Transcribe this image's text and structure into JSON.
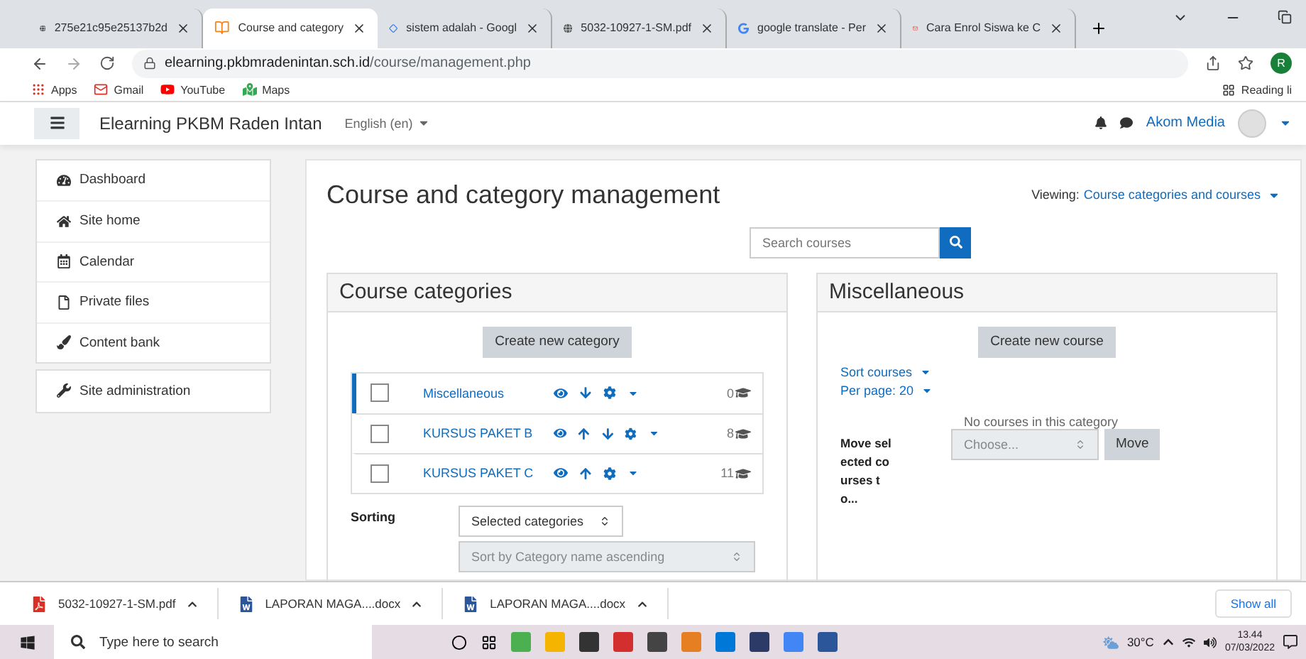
{
  "browser": {
    "tabs": [
      {
        "title": "275e21c95e25137b2d",
        "selected": false,
        "kind": "globe"
      },
      {
        "title": "Course and category",
        "selected": true,
        "kind": "moodle"
      },
      {
        "title": "sistem adalah - Googl",
        "selected": false,
        "kind": "diamond"
      },
      {
        "title": "5032-10927-1-SM.pdf",
        "selected": false,
        "kind": "globe"
      },
      {
        "title": "google translate - Per",
        "selected": false,
        "kind": "google"
      },
      {
        "title": "Cara Enrol Siswa ke C",
        "selected": false,
        "kind": "mail"
      }
    ],
    "address": {
      "host": "elearning.pkbmradenintan.sch.id",
      "path": "/course/management.php"
    },
    "profile_letter": "R",
    "bookmarks": [
      {
        "label": "Apps",
        "kind": "apps"
      },
      {
        "label": "Gmail",
        "kind": "gmail"
      },
      {
        "label": "YouTube",
        "kind": "youtube"
      },
      {
        "label": "Maps",
        "kind": "maps"
      }
    ],
    "reading_list": "Reading li"
  },
  "navbar": {
    "site_name": "Elearning PKBM Raden Intan",
    "language": "English (en)",
    "user": "Akom Media"
  },
  "sidebar": {
    "groups": [
      [
        {
          "label": "Dashboard",
          "kind": "dashboard"
        },
        {
          "label": "Site home",
          "kind": "home"
        },
        {
          "label": "Calendar",
          "kind": "calendar"
        },
        {
          "label": "Private files",
          "kind": "file"
        },
        {
          "label": "Content bank",
          "kind": "brush"
        }
      ],
      [
        {
          "label": "Site administration",
          "kind": "wrench"
        }
      ]
    ]
  },
  "page": {
    "title": "Course and category management",
    "viewing_label": "Viewing:",
    "viewing_value": "Course categories and courses",
    "search": {
      "placeholder": "Search courses"
    }
  },
  "categories_panel": {
    "title": "Course categories",
    "create_button": "Create new category",
    "rows": [
      {
        "name": "Miscellaneous",
        "count": "0",
        "selected": true,
        "checked": false,
        "can_move_up": false,
        "can_move_down": true
      },
      {
        "name": "KURSUS PAKET B",
        "count": "8",
        "selected": false,
        "checked": false,
        "can_move_up": true,
        "can_move_down": true
      },
      {
        "name": "KURSUS PAKET C",
        "count": "11",
        "selected": false,
        "checked": false,
        "can_move_up": true,
        "can_move_down": false
      }
    ],
    "sorting_label": "Sorting",
    "sorting_select": "Selected categories",
    "sort_by_select": "Sort by Category name ascending"
  },
  "courses_panel": {
    "title": "Miscellaneous",
    "create_button": "Create new course",
    "sort_link": "Sort courses",
    "per_page_link": "Per page: 20",
    "empty_text": "No courses in this category",
    "move_label": "Move selected courses to...",
    "move_select": {
      "placeholder": "Choose..."
    },
    "move_button": "Move"
  },
  "downloads": {
    "items": [
      {
        "name": "5032-10927-1-SM.pdf",
        "kind": "pdf"
      },
      {
        "name": "LAPORAN MAGA....docx",
        "kind": "doc"
      },
      {
        "name": "LAPORAN MAGA....docx",
        "kind": "doc"
      }
    ],
    "show_all": "Show all"
  },
  "taskbar": {
    "search": {
      "placeholder": "Type here to search"
    },
    "temperature": "30°C",
    "time": "13.44",
    "date": "07/03/2022"
  }
}
